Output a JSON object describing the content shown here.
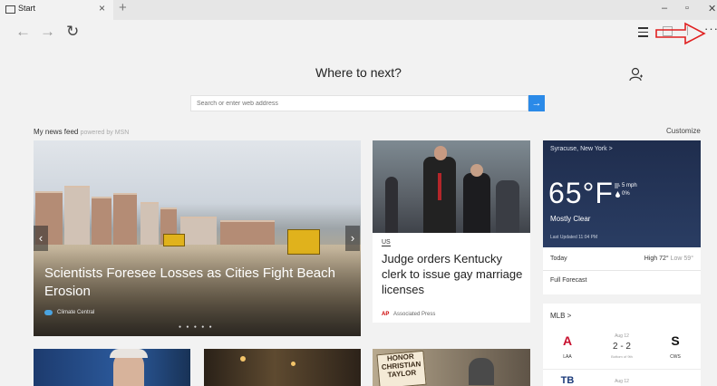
{
  "tab": {
    "title": "Start",
    "close": "×",
    "new_tab": "+"
  },
  "window_controls": {
    "minimize": "–",
    "restore": "▫",
    "close": "✕"
  },
  "nav": {
    "back": "←",
    "forward": "→",
    "refresh": "↻",
    "more": "···"
  },
  "start": {
    "title": "Where to next?",
    "search_placeholder": "Search or enter web address",
    "search_button": "→"
  },
  "feed": {
    "label": "My news feed",
    "powered": "powered by MSN",
    "customize": "Customize"
  },
  "main_story": {
    "headline": "Scientists Foresee Losses as Cities Fight Beach Erosion",
    "source": "Climate Central",
    "prev": "‹",
    "next": "›",
    "dots": "● ● ● ● ●"
  },
  "story_2": {
    "category": "US",
    "headline": "Judge orders Kentucky clerk to issue gay marriage licenses",
    "source_logo": "AP",
    "source": "Associated Press"
  },
  "weather": {
    "city": "Syracuse, New York  >",
    "temp": "65°F",
    "wind": "5 mph",
    "precip": "0%",
    "condition": "Mostly Clear",
    "updated": "Last Updated 11:04 PM",
    "today": "Today",
    "high": "High 72°",
    "low": "Low 59°",
    "full_forecast": "Full Forecast"
  },
  "mlb": {
    "title": "MLB  >",
    "game1": {
      "date": "Aug 12",
      "score": "2 - 2",
      "status": "Bottom of 9th",
      "home": "LAA",
      "away": "CWS"
    },
    "game2": {
      "date": "Aug 12"
    }
  },
  "colors": {
    "accent": "#2b8ae8",
    "annotation": "#e02020",
    "weather_bg": "#1f2d4d"
  }
}
